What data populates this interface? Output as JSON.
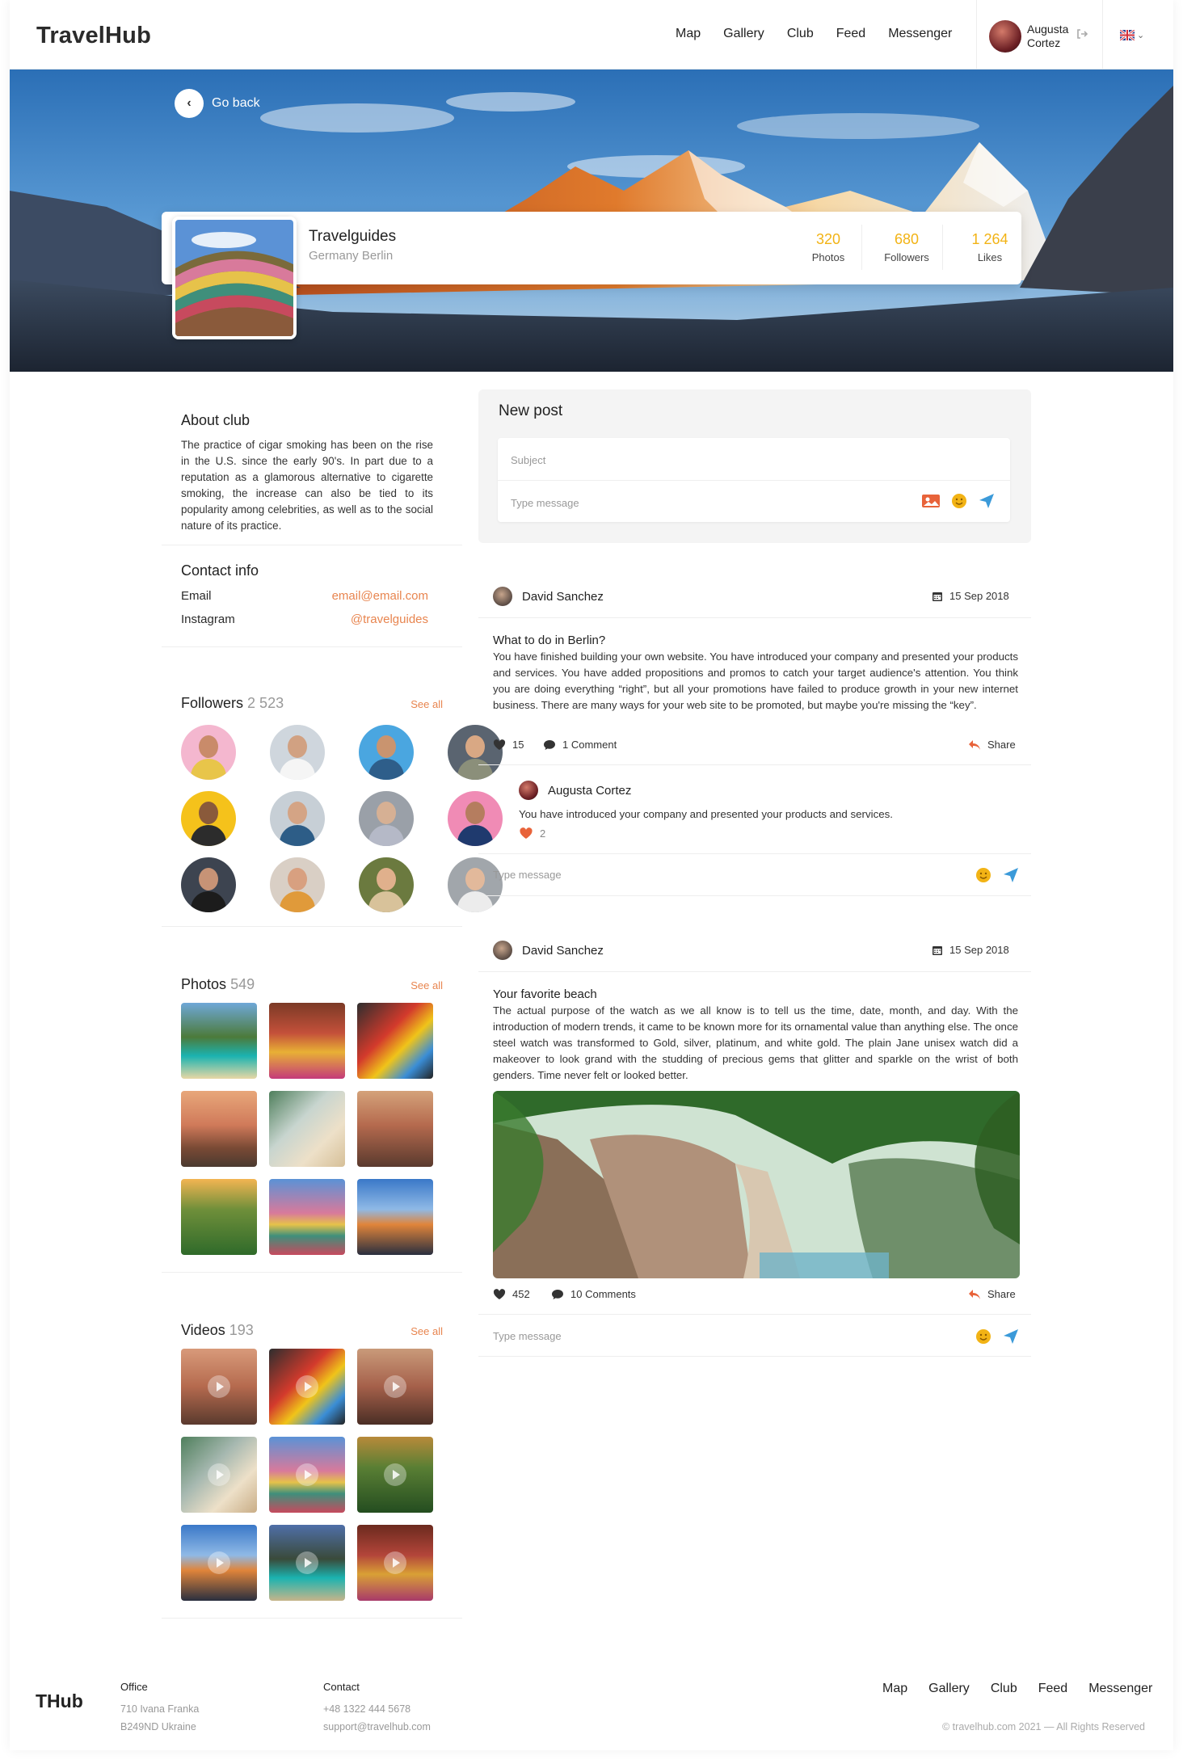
{
  "header": {
    "logo": "TravelHub",
    "nav": [
      "Map",
      "Gallery",
      "Club",
      "Feed",
      "Messenger"
    ],
    "user_first": "Augusta",
    "user_last": "Cortez"
  },
  "hero": {
    "go_back": "Go back",
    "club_name": "Travelguides",
    "club_location": "Germany Berlin",
    "stats": [
      {
        "value": "320",
        "label": "Photos"
      },
      {
        "value": "680",
        "label": "Followers"
      },
      {
        "value": "1 264",
        "label": "Likes"
      }
    ]
  },
  "about": {
    "title": "About club",
    "text": "The practice of cigar smoking has been on the rise in the U.S. since the early 90's. In part due to a reputation as a glamorous alternative to cigarette smoking, the increase can also be tied to its popularity among celebrities, as well as to the social nature of its practice."
  },
  "contact": {
    "title": "Contact info",
    "rows": [
      {
        "label": "Email",
        "value": "email@email.com"
      },
      {
        "label": "Instagram",
        "value": "@travelguides"
      }
    ]
  },
  "followers": {
    "title": "Followers",
    "count": "2 523",
    "see_all": "See all"
  },
  "photos": {
    "title": "Photos",
    "count": "549",
    "see_all": "See all"
  },
  "videos": {
    "title": "Videos",
    "count": "193",
    "see_all": "See all"
  },
  "new_post": {
    "title": "New post",
    "subject_placeholder": "Subject",
    "message_placeholder": "Type message"
  },
  "posts": [
    {
      "author": "David Sanchez",
      "date": "15 Sep 2018",
      "title": "What to do in Berlin?",
      "body": "You have finished building your own website. You have introduced your company and presented your products and services. You have added propositions and promos to catch your target audience's attention. You think you are doing everything “right”, but all your promotions have failed to produce growth in your new internet business. There are many ways for your web site to be promoted, but maybe you're missing the “key”.",
      "likes": "15",
      "comments": "1 Comment",
      "share": "Share",
      "reply": {
        "author": "Augusta Cortez",
        "text": "You have introduced your company and presented your products and services.",
        "likes": "2"
      },
      "type_message": "Type message"
    },
    {
      "author": "David Sanchez",
      "date": "15 Sep 2018",
      "title": "Your favorite beach",
      "body": "The actual purpose of the watch as we all know is to tell us the time, date, month, and day. With the introduction of modern trends, it came to be known more for its ornamental value than anything else. The once steel watch was transformed to Gold, silver, platinum, and white gold. The plain Jane unisex watch did a makeover to look grand with the studding of precious gems that glitter and sparkle on the wrist of both genders. Time never felt or looked better.",
      "likes": "452",
      "comments": "10 Comments",
      "share": "Share",
      "type_message": "Type message"
    }
  ],
  "footer": {
    "logo": "THub",
    "office_title": "Office",
    "office_line1": "710 Ivana Franka",
    "office_line2": "B249ND Ukraine",
    "contact_title": "Contact",
    "contact_phone": "+48 1322 444 5678",
    "contact_email": "support@travelhub.com",
    "nav": [
      "Map",
      "Gallery",
      "Club",
      "Feed",
      "Messenger"
    ],
    "copyright": "© travelhub.com 2021 — All Rights Reserved"
  },
  "colors": {
    "accent": "#f2b315",
    "link": "#e8854f",
    "send": "#3b9ad9"
  }
}
